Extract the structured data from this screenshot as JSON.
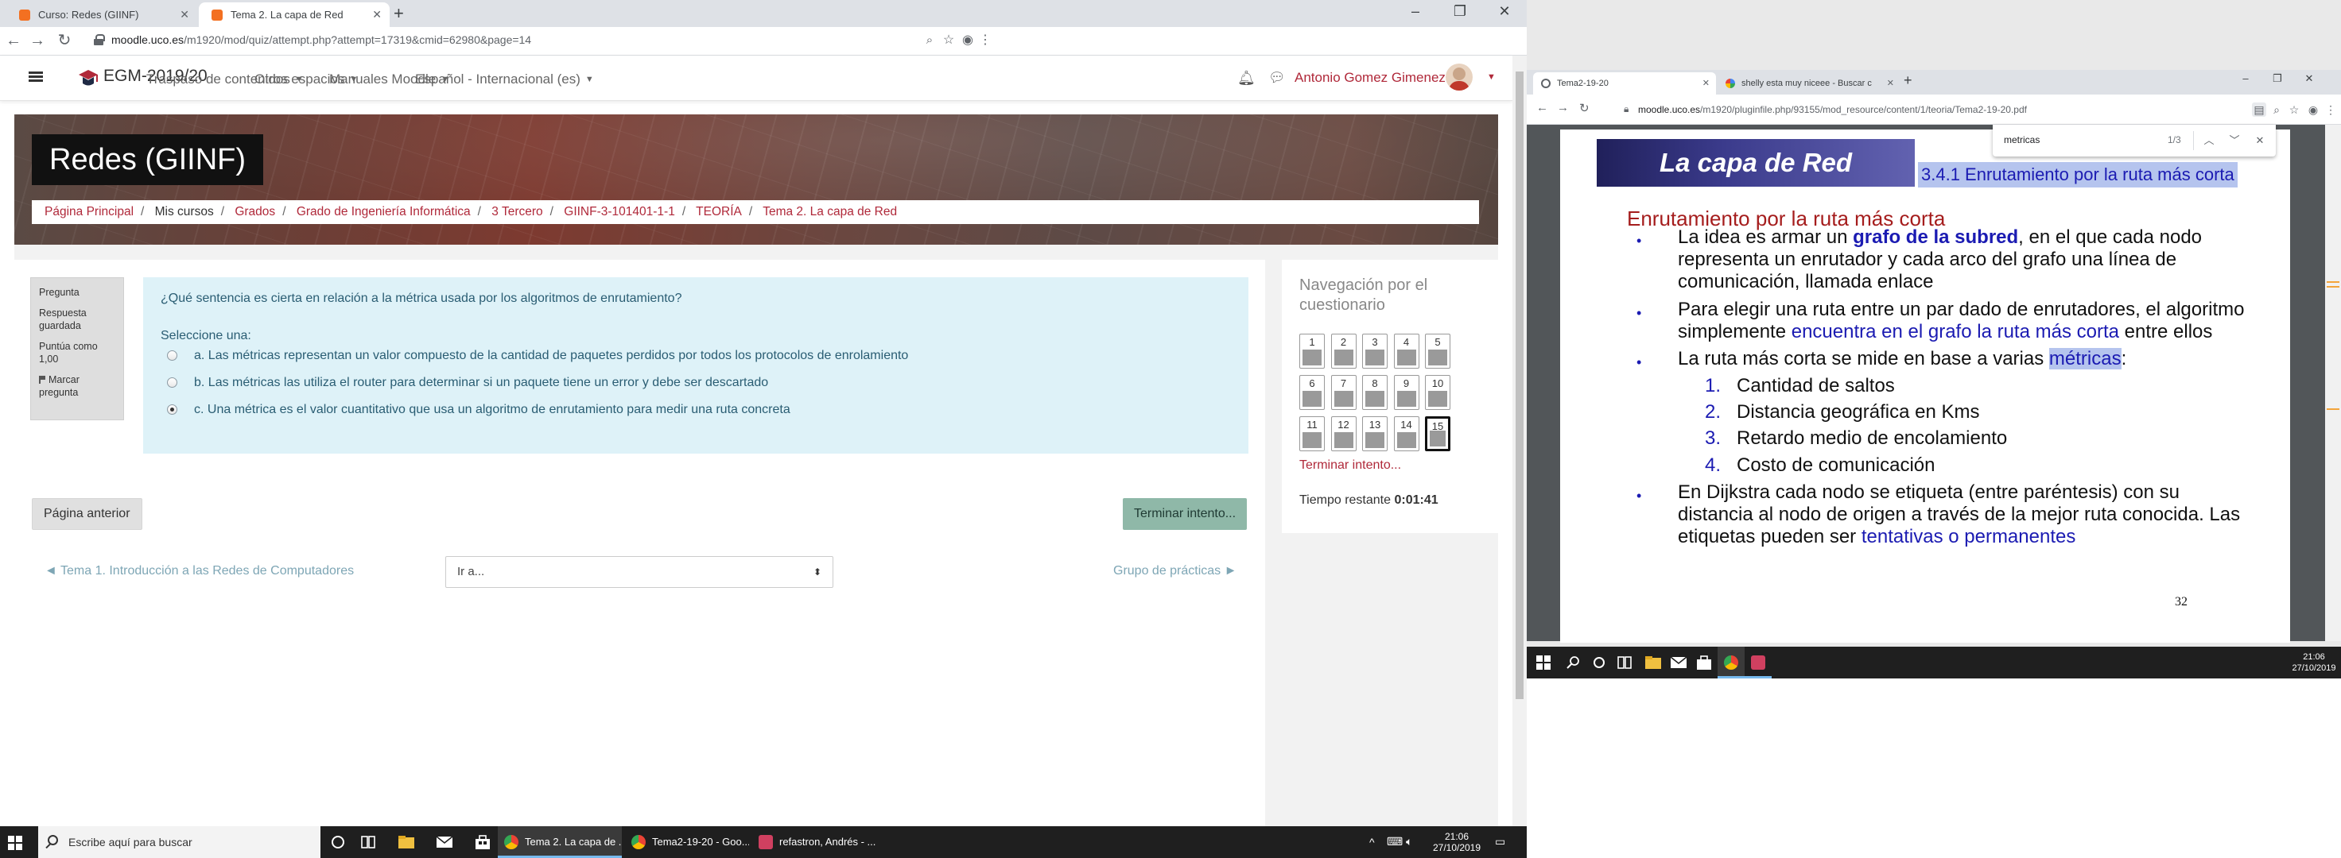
{
  "left_browser": {
    "tabs": [
      {
        "label": "Curso: Redes (GIINF)",
        "active": false
      },
      {
        "label": "Tema 2. La capa de Red",
        "active": true
      }
    ],
    "url_host": "moodle.uco.es",
    "url_path": "/m1920/mod/quiz/attempt.php?attempt=17319&cmid=62980&page=14"
  },
  "moodle": {
    "site_name": "EGM-2019/20",
    "menu": [
      "Traspaso de contenidos",
      "Otros espacios",
      "Manuales Moodle",
      "Español - Internacional (es)"
    ],
    "user_name": "Antonio Gomez Gimenez",
    "course_title": "Redes (GIINF)",
    "breadcrumb": [
      {
        "label": "Página Principal",
        "link": true
      },
      {
        "label": "Mis cursos",
        "link": false
      },
      {
        "label": "Grados",
        "link": true
      },
      {
        "label": "Grado de Ingeniería Informática",
        "link": true
      },
      {
        "label": "3 Tercero",
        "link": true
      },
      {
        "label": "GIINF-3-101401-1-1",
        "link": true
      },
      {
        "label": "TEORÍA",
        "link": true
      },
      {
        "label": "Tema 2. La capa de Red",
        "link": true
      }
    ]
  },
  "question": {
    "label": "Pregunta",
    "number": "15",
    "state": "Respuesta guardada",
    "mark": "Puntúa como 1,00",
    "flag": "Marcar pregunta",
    "text": "¿Qué sentencia es cierta en relación a la métrica usada por los algoritmos de enrutamiento?",
    "prompt": "Seleccione una:",
    "options": [
      {
        "text": "a. Las métricas representan un valor compuesto de la cantidad de paquetes perdidos por todos los protocolos de enrolamiento",
        "checked": false
      },
      {
        "text": "b. Las métricas las utiliza el router para determinar si un paquete tiene un error y debe ser descartado",
        "checked": false
      },
      {
        "text": "c. Una métrica es el valor cuantitativo que usa un algoritmo de enrutamiento para medir una ruta concreta",
        "checked": true
      }
    ]
  },
  "buttons": {
    "prev_page": "Página anterior",
    "finish": "Terminar intento..."
  },
  "activity_nav": {
    "prev": "◄ Tema 1. Introducción a las Redes de Computadores",
    "jump": "Ir a...",
    "next": "Grupo de prácticas ►"
  },
  "quiz_nav": {
    "title": "Navegación por el cuestionario",
    "buttons": [
      "1",
      "2",
      "3",
      "4",
      "5",
      "6",
      "7",
      "8",
      "9",
      "10",
      "11",
      "12",
      "13",
      "14",
      "15"
    ],
    "current": "15",
    "finish_link": "Terminar intento...",
    "time_label": "Tiempo restante",
    "time_value": "0:01:41"
  },
  "left_taskbar": {
    "search_placeholder": "Escribe aquí para buscar",
    "apps": [
      {
        "label": "Tema 2. La capa de ...",
        "active": true
      },
      {
        "label": "Tema2-19-20 - Goo...",
        "active": false
      },
      {
        "label": "refastron, Andrés - ...",
        "active": false
      }
    ],
    "time": "21:06",
    "date": "27/10/2019"
  },
  "right_browser": {
    "tabs": [
      {
        "label": "Tema2-19-20",
        "active": true
      },
      {
        "label": "shelly esta muy niceee - Buscar c",
        "active": false
      }
    ],
    "url_host": "moodle.uco.es",
    "url_path": "/m1920/pluginfile.php/93155/mod_resource/content/1/teoria/Tema2-19-20.pdf",
    "find_query": "metricas",
    "find_count": "1/3"
  },
  "slide": {
    "header": "La capa de Red",
    "section": "3.4.1 Enrutamiento por la ruta más corta",
    "heading": "Enrutamiento por la ruta más corta",
    "b1_pre": "La idea es armar un ",
    "b1_kw": "grafo de la subred",
    "b1_post": ", en el que cada nodo representa un enrutador y cada arco del grafo una línea de comunicación, llamada enlace",
    "b2_pre": "Para elegir una ruta entre un par dado de enrutadores, el algoritmo simplemente ",
    "b2_kw": "encuentra en el grafo la ruta más corta",
    "b2_post": " entre ellos",
    "b3_pre": "La ruta más corta se mide en base a varias ",
    "b3_kw": "métricas",
    "b3_post": ":",
    "list": [
      {
        "n": "1.",
        "t": "Cantidad de saltos"
      },
      {
        "n": "2.",
        "t": "Distancia geográfica en Kms"
      },
      {
        "n": "3.",
        "t": "Retardo medio de encolamiento"
      },
      {
        "n": "4.",
        "t": "Costo de comunicación"
      }
    ],
    "b4_pre": "En Dijkstra cada nodo se etiqueta (entre paréntesis) con su distancia al nodo de origen a través de la mejor ruta conocida. Las etiquetas pueden ser ",
    "b4_kw": "tentativas o permanentes",
    "page_number": "32"
  },
  "right_taskbar": {
    "time": "21:06",
    "date": "27/10/2019"
  }
}
